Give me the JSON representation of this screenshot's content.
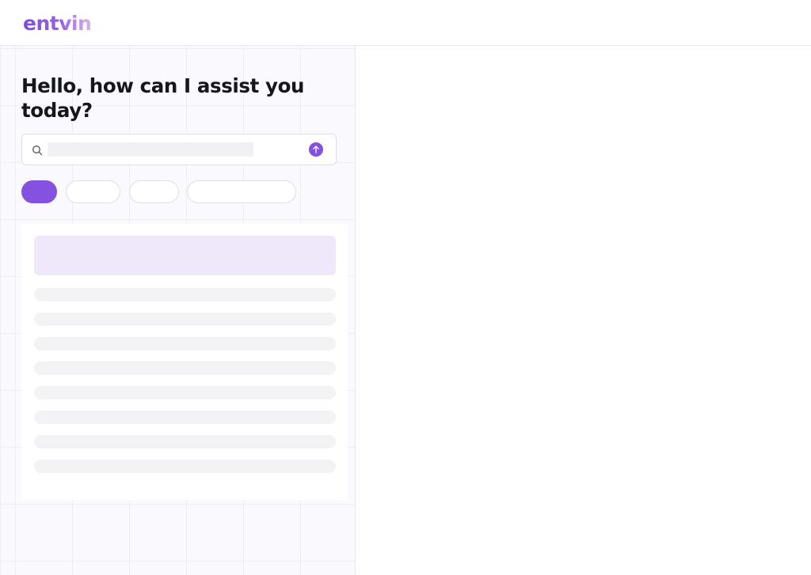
{
  "app": {
    "logo_text": "entvin",
    "brand_color": "#8451e0"
  },
  "assistant": {
    "headline": "Hello, how can I assist you today?",
    "search": {
      "value": "",
      "placeholder": "",
      "icon": "search-icon",
      "send_icon": "arrow-up-icon"
    },
    "chips": [
      {
        "label": "",
        "active": true
      },
      {
        "label": "",
        "active": false
      },
      {
        "label": "",
        "active": false
      },
      {
        "label": "",
        "active": false
      }
    ],
    "results": {
      "state": "loading",
      "skeleton_row_count": 8
    }
  }
}
